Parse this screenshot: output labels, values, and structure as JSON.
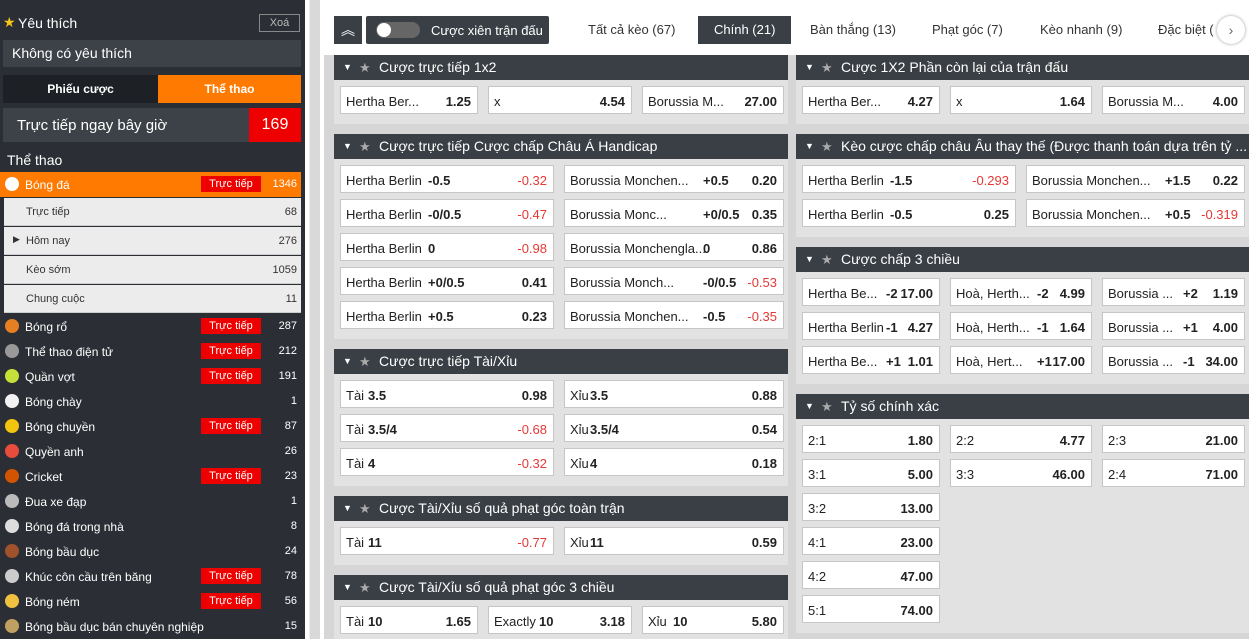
{
  "sidebar": {
    "fav_title": "Yêu thích",
    "fav_clear": "Xoá",
    "no_fav": "Không có yêu thích",
    "tab_slip": "Phiếu cược",
    "tab_sports": "Thể thao",
    "live_now": "Trực tiếp ngay bây giờ",
    "live_count": "169",
    "section": "Thể thao",
    "live_badge": "Trực tiếp",
    "sports": [
      {
        "label": "Bóng đá",
        "count": "1346",
        "live": true,
        "icon": "soccer-ball-icon",
        "color": "#ffffff"
      },
      {
        "label": "Bóng rổ",
        "count": "287",
        "live": true,
        "icon": "basketball-icon",
        "color": "#e67e22"
      },
      {
        "label": "Thể thao điện tử",
        "count": "212",
        "live": true,
        "icon": "gamepad-icon",
        "color": "#999999"
      },
      {
        "label": "Quần vợt",
        "count": "191",
        "live": true,
        "icon": "tennis-ball-icon",
        "color": "#c6e03a"
      },
      {
        "label": "Bóng chày",
        "count": "1",
        "live": false,
        "icon": "baseball-icon",
        "color": "#f2f2f2"
      },
      {
        "label": "Bóng chuyền",
        "count": "87",
        "live": true,
        "icon": "volleyball-icon",
        "color": "#f1c40f"
      },
      {
        "label": "Quyền anh",
        "count": "26",
        "live": false,
        "icon": "boxing-glove-icon",
        "color": "#e74c3c"
      },
      {
        "label": "Cricket",
        "count": "23",
        "live": true,
        "icon": "cricket-bat-icon",
        "color": "#d35400"
      },
      {
        "label": "Đua xe đạp",
        "count": "1",
        "live": false,
        "icon": "bicycle-icon",
        "color": "#bbbbbb"
      },
      {
        "label": "Bóng đá trong nhà",
        "count": "8",
        "live": false,
        "icon": "futsal-icon",
        "color": "#dddddd"
      },
      {
        "label": "Bóng bầu dục",
        "count": "24",
        "live": false,
        "icon": "rugby-ball-icon",
        "color": "#a0522d"
      },
      {
        "label": "Khúc côn cầu trên băng",
        "count": "78",
        "live": true,
        "icon": "hockey-stick-icon",
        "color": "#cccccc"
      },
      {
        "label": "Bóng ném",
        "count": "56",
        "live": true,
        "icon": "handball-icon",
        "color": "#f0c040"
      },
      {
        "label": "Bóng bầu dục bán chuyên nghiệp",
        "count": "15",
        "live": false,
        "icon": "rugby-league-icon",
        "color": "#c0a060"
      }
    ],
    "subs": [
      {
        "label": "Trực tiếp",
        "count": "68"
      },
      {
        "label": "Hôm nay",
        "count": "276"
      },
      {
        "label": "Kèo sớm",
        "count": "1059"
      },
      {
        "label": "Chung cuộc",
        "count": "11"
      }
    ]
  },
  "toolbar": {
    "parlay": "Cược xiên trận đấu",
    "tabs": [
      "Tất cả kèo (67)",
      "Chính (21)",
      "Bàn thắng (13)",
      "Phạt góc (7)",
      "Kèo nhanh (9)",
      "Đặc biệt ("
    ]
  },
  "markets": {
    "m1": {
      "title": "Cược trực tiếp 1x2",
      "rows": [
        [
          [
            "Hertha Ber...",
            "",
            "1.25"
          ],
          [
            "x",
            "",
            "4.54"
          ],
          [
            "Borussia M...",
            "",
            "27.00"
          ]
        ]
      ]
    },
    "m2": {
      "title": "Cược trực tiếp Cược chấp Châu Á Handicap",
      "rows": [
        [
          [
            "Hertha Berlin",
            "-0.5",
            "-0.32"
          ],
          [
            "Borussia Monchen...",
            "+0.5",
            "0.20"
          ]
        ],
        [
          [
            "Hertha Berlin",
            "-0/0.5",
            "-0.47"
          ],
          [
            "Borussia Monc...",
            "+0/0.5",
            "0.35"
          ]
        ],
        [
          [
            "Hertha Berlin",
            "0",
            "-0.98"
          ],
          [
            "Borussia Monchengla...",
            "0",
            "0.86"
          ]
        ],
        [
          [
            "Hertha Berlin",
            "+0/0.5",
            "0.41"
          ],
          [
            "Borussia Monch...",
            "-0/0.5",
            "-0.53"
          ]
        ],
        [
          [
            "Hertha Berlin",
            "+0.5",
            "0.23"
          ],
          [
            "Borussia Monchen...",
            "-0.5",
            "-0.35"
          ]
        ]
      ]
    },
    "m3": {
      "title": "Cược trực tiếp Tài/Xỉu",
      "rows": [
        [
          [
            "Tài",
            "3.5",
            "0.98"
          ],
          [
            "Xỉu",
            "3.5",
            "0.88"
          ]
        ],
        [
          [
            "Tài",
            "3.5/4",
            "-0.68"
          ],
          [
            "Xỉu",
            "3.5/4",
            "0.54"
          ]
        ],
        [
          [
            "Tài",
            "4",
            "-0.32"
          ],
          [
            "Xỉu",
            "4",
            "0.18"
          ]
        ]
      ]
    },
    "m4": {
      "title": "Cược Tài/Xỉu số quả phạt góc toàn trận",
      "rows": [
        [
          [
            "Tài",
            "11",
            "-0.77"
          ],
          [
            "Xỉu",
            "11",
            "0.59"
          ]
        ]
      ]
    },
    "m5": {
      "title": "Cược Tài/Xỉu số quả phạt góc 3 chiều",
      "rows": [
        [
          [
            "Tài",
            "10",
            "1.65"
          ],
          [
            "Exactly",
            "10",
            "3.18"
          ],
          [
            "Xỉu",
            "10",
            "5.80"
          ]
        ]
      ]
    },
    "m6": {
      "title": "Cược 1X2 Phần còn lại của trận đấu",
      "rows": [
        [
          [
            "Hertha Ber...",
            "",
            "4.27"
          ],
          [
            "x",
            "",
            "1.64"
          ],
          [
            "Borussia M...",
            "",
            "4.00"
          ]
        ]
      ]
    },
    "m7": {
      "title": "Kèo cược chấp châu Âu thay thế (Được thanh toán dựa trên tỷ ...",
      "rows": [
        [
          [
            "Hertha Berlin",
            "-1.5",
            "-0.293"
          ],
          [
            "Borussia Monchen...",
            "+1.5",
            "0.22"
          ]
        ],
        [
          [
            "Hertha Berlin",
            "-0.5",
            "0.25"
          ],
          [
            "Borussia Monchen...",
            "+0.5",
            "-0.319"
          ]
        ]
      ]
    },
    "m8": {
      "title": "Cược chấp 3 chiều",
      "rows": [
        [
          [
            "Hertha Be...",
            "-2",
            "17.00"
          ],
          [
            "Hoà, Herth...",
            "-2",
            "4.99"
          ],
          [
            "Borussia ...",
            "+2",
            "1.19"
          ]
        ],
        [
          [
            "Hertha Berlin",
            "-1",
            "4.27"
          ],
          [
            "Hoà, Herth...",
            "-1",
            "1.64"
          ],
          [
            "Borussia ...",
            "+1",
            "4.00"
          ]
        ],
        [
          [
            "Hertha Be...",
            "+1",
            "1.01"
          ],
          [
            "Hoà, Hert...",
            "+1",
            "17.00"
          ],
          [
            "Borussia ...",
            "-1",
            "34.00"
          ]
        ]
      ]
    },
    "m9": {
      "title": "Tỷ số chính xác",
      "rows": [
        [
          [
            "2:1",
            "",
            "1.80"
          ],
          [
            "2:2",
            "",
            "4.77"
          ],
          [
            "2:3",
            "",
            "21.00"
          ]
        ],
        [
          [
            "3:1",
            "",
            "5.00"
          ],
          [
            "3:3",
            "",
            "46.00"
          ],
          [
            "2:4",
            "",
            "71.00"
          ]
        ],
        [
          [
            "3:2",
            "",
            "13.00"
          ]
        ],
        [
          [
            "4:1",
            "",
            "23.00"
          ]
        ],
        [
          [
            "4:2",
            "",
            "47.00"
          ]
        ],
        [
          [
            "5:1",
            "",
            "74.00"
          ]
        ]
      ]
    }
  }
}
